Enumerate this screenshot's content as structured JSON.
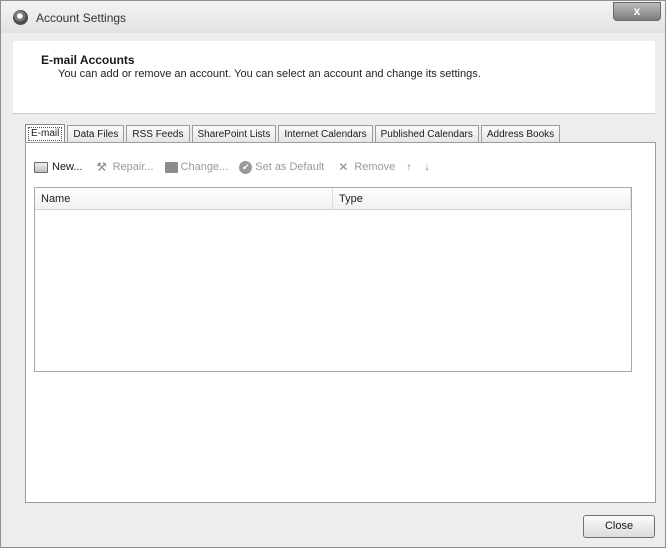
{
  "window": {
    "title": "Account Settings",
    "close_glyph": "x",
    "icon": "account-settings-icon"
  },
  "header": {
    "title": "E-mail Accounts",
    "description": "You can add or remove an account. You can select an account and change its settings."
  },
  "tabs": [
    {
      "label": "E-mail",
      "active": true
    },
    {
      "label": "Data Files",
      "active": false
    },
    {
      "label": "RSS Feeds",
      "active": false
    },
    {
      "label": "SharePoint Lists",
      "active": false
    },
    {
      "label": "Internet Calendars",
      "active": false
    },
    {
      "label": "Published Calendars",
      "active": false
    },
    {
      "label": "Address Books",
      "active": false
    }
  ],
  "toolbar": {
    "new_label": "New...",
    "repair_label": "Repair...",
    "change_label": "Change...",
    "set_default_label": "Set as Default",
    "remove_label": "Remove",
    "move_up_glyph": "↑",
    "move_down_glyph": "↓",
    "repair_glyph": "⚒",
    "remove_glyph": "✕",
    "default_glyph": "✔"
  },
  "list": {
    "columns": [
      "Name",
      "Type"
    ],
    "rows": []
  },
  "footer": {
    "close_label": "Close"
  }
}
